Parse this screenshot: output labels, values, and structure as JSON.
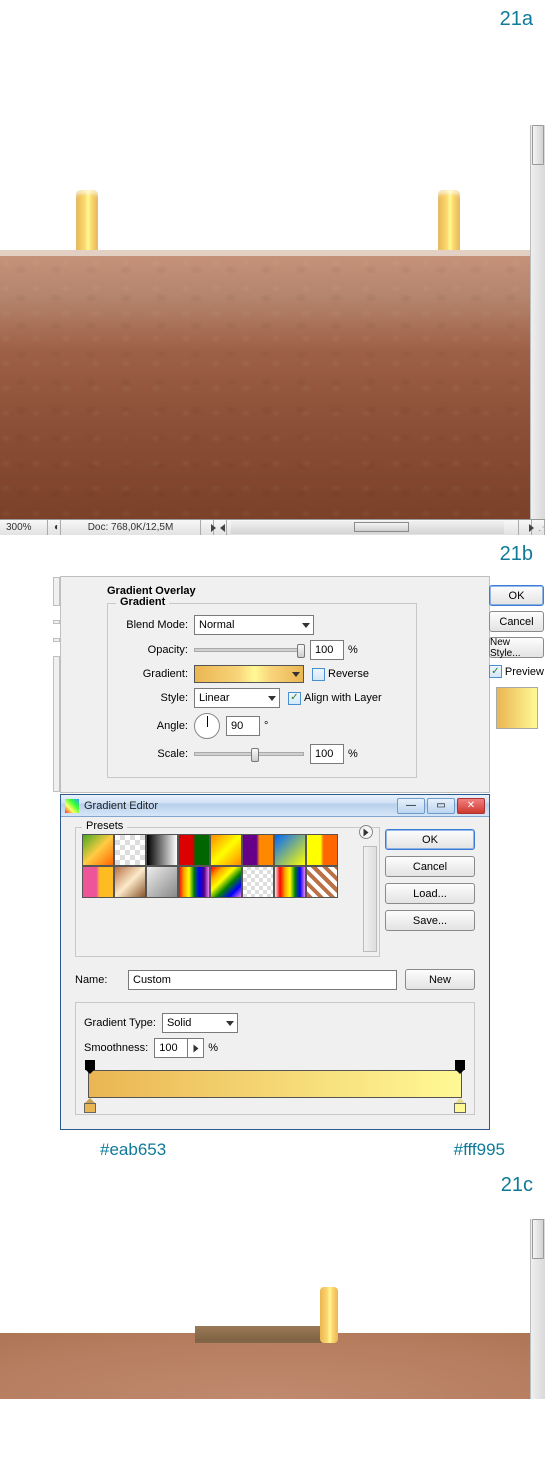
{
  "steps": {
    "s21a": "21a",
    "s21b": "21b",
    "s21c": "21c"
  },
  "status": {
    "zoom": "300%",
    "doc": "Doc: 768,0K/12,5M"
  },
  "overlay": {
    "section_title": "Gradient Overlay",
    "fieldset_title": "Gradient",
    "blend_label": "Blend Mode:",
    "blend_value": "Normal",
    "opacity_label": "Opacity:",
    "opacity_value": "100",
    "percent": "%",
    "gradient_label": "Gradient:",
    "reverse_label": "Reverse",
    "style_label": "Style:",
    "style_value": "Linear",
    "align_label": "Align with Layer",
    "angle_label": "Angle:",
    "angle_value": "90",
    "degree": "°",
    "scale_label": "Scale:",
    "scale_value": "100",
    "btn_ok": "OK",
    "btn_cancel": "Cancel",
    "btn_newstyle": "New Style...",
    "preview_label": "Preview"
  },
  "editor": {
    "window_title": "Gradient Editor",
    "presets_label": "Presets",
    "btn_ok": "OK",
    "btn_cancel": "Cancel",
    "btn_load": "Load...",
    "btn_save": "Save...",
    "name_label": "Name:",
    "name_value": "Custom",
    "btn_new": "New",
    "gtype_label": "Gradient Type:",
    "gtype_value": "Solid",
    "smooth_label": "Smoothness:",
    "smooth_value": "100",
    "percent": "%"
  },
  "colors": {
    "left": "#eab653",
    "right": "#fff995"
  }
}
